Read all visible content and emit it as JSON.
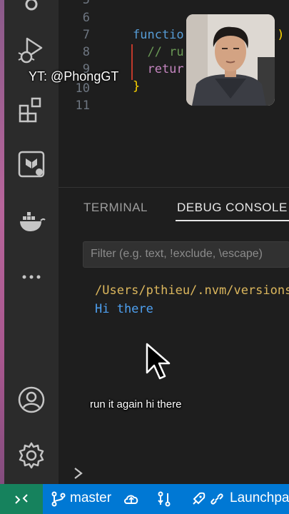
{
  "editor": {
    "lines": [
      {
        "no": "6",
        "text": ""
      },
      {
        "no": "7",
        "text": "functio"
      },
      {
        "no": "8",
        "text": "  // ru"
      },
      {
        "no": "9",
        "text": "  retur"
      },
      {
        "no": "10",
        "text": "}"
      },
      {
        "no": "11",
        "text": ""
      }
    ],
    "paren_fragment": "()",
    "line_5_partial": "5"
  },
  "panel": {
    "tabs": [
      "TERMINAL",
      "DEBUG CONSOLE"
    ],
    "active_tab": "DEBUG CONSOLE",
    "filter_placeholder": "Filter (e.g. text, !exclude, \\escape)",
    "console_lines": [
      "/Users/pthieu/.nvm/versions",
      "Hi there"
    ]
  },
  "status_bar": {
    "branch": "master",
    "launchpad": "Launchpad"
  },
  "overlay": {
    "watermark": "YT: @PhongGT",
    "caption": "run it again hi there"
  },
  "colors": {
    "keyword": "#569cd6",
    "comment": "#6a9955",
    "path_yellow": "#dcb75d",
    "hi_there_blue": "#4ea0f0",
    "status_blue": "#0078d4",
    "remote_green": "#16825d"
  }
}
